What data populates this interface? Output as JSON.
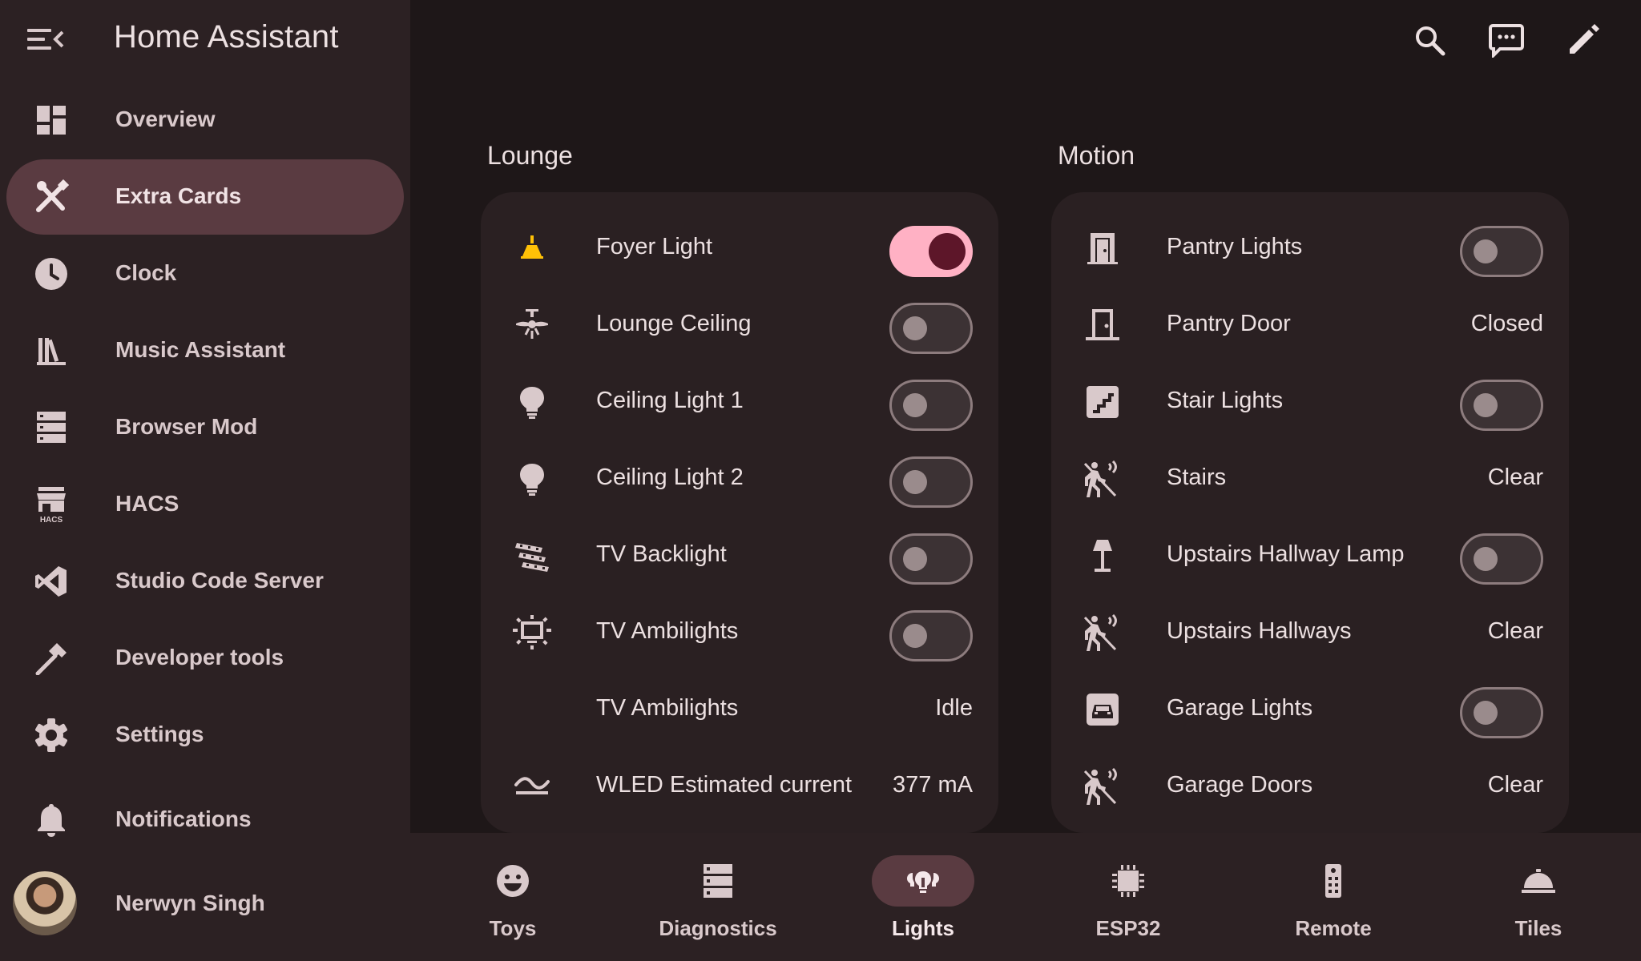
{
  "app": {
    "title": "Home Assistant"
  },
  "sidebar": {
    "items": [
      {
        "label": "Overview",
        "icon": "dashboard-icon"
      },
      {
        "label": "Extra Cards",
        "icon": "tools-icon",
        "active": true
      },
      {
        "label": "Clock",
        "icon": "clock-icon"
      },
      {
        "label": "Music Assistant",
        "icon": "music-library-icon"
      },
      {
        "label": "Browser Mod",
        "icon": "server-icon"
      },
      {
        "label": "HACS",
        "icon": "hacs-icon"
      },
      {
        "label": "Studio Code Server",
        "icon": "vscode-icon"
      },
      {
        "label": "Developer tools",
        "icon": "hammer-icon"
      },
      {
        "label": "Settings",
        "icon": "gear-icon"
      },
      {
        "label": "Notifications",
        "icon": "bell-icon"
      }
    ],
    "user": {
      "name": "Nerwyn Singh"
    }
  },
  "topbar": {
    "icons": [
      "search-icon",
      "assist-chat-icon",
      "edit-pencil-icon"
    ]
  },
  "sections": {
    "lounge": {
      "title": "Lounge",
      "rows": [
        {
          "name": "Foyer Light",
          "icon": "ceiling-light-icon",
          "type": "toggle",
          "on": true
        },
        {
          "name": "Lounge Ceiling",
          "icon": "ceiling-fan-light-icon",
          "type": "toggle",
          "on": false
        },
        {
          "name": "Ceiling Light 1",
          "icon": "lightbulb-icon",
          "type": "toggle",
          "on": false
        },
        {
          "name": "Ceiling Light 2",
          "icon": "lightbulb-icon",
          "type": "toggle",
          "on": false
        },
        {
          "name": "TV Backlight",
          "icon": "led-strip-icon",
          "type": "toggle",
          "on": false
        },
        {
          "name": "TV Ambilights",
          "icon": "television-ambient-light-icon",
          "type": "toggle",
          "on": false
        },
        {
          "name": "TV Ambilights",
          "icon": "",
          "type": "state",
          "state": "Idle"
        },
        {
          "name": "WLED Estimated current",
          "icon": "current-ac-icon",
          "type": "state",
          "state": "377 mA"
        }
      ]
    },
    "motion": {
      "title": "Motion",
      "rows": [
        {
          "name": "Pantry Lights",
          "icon": "door-light-icon",
          "type": "toggle",
          "on": false
        },
        {
          "name": "Pantry Door",
          "icon": "door-closed-icon",
          "type": "state",
          "state": "Closed"
        },
        {
          "name": "Stair Lights",
          "icon": "stairs-icon",
          "type": "toggle",
          "on": false
        },
        {
          "name": "Stairs",
          "icon": "motion-sensor-icon",
          "type": "state",
          "state": "Clear"
        },
        {
          "name": "Upstairs Hallway Lamp",
          "icon": "floor-lamp-icon",
          "type": "toggle",
          "on": false
        },
        {
          "name": "Upstairs Hallways",
          "icon": "motion-sensor-icon",
          "type": "state",
          "state": "Clear"
        },
        {
          "name": "Garage Lights",
          "icon": "garage-car-icon",
          "type": "toggle",
          "on": false
        },
        {
          "name": "Garage Doors",
          "icon": "motion-sensor-icon",
          "type": "state",
          "state": "Clear"
        }
      ]
    }
  },
  "bottom_nav": [
    {
      "label": "Toys",
      "icon": "emoticon-icon"
    },
    {
      "label": "Diagnostics",
      "icon": "server-icon"
    },
    {
      "label": "Lights",
      "icon": "lightbulb-group-icon",
      "active": true
    },
    {
      "label": "ESP32",
      "icon": "chip-icon"
    },
    {
      "label": "Remote",
      "icon": "remote-icon"
    },
    {
      "label": "Tiles",
      "icon": "room-service-icon"
    }
  ],
  "colors": {
    "accent": "#ffb1c4",
    "active_pill": "#5a3b41",
    "foyer_icon": "#ffc107",
    "background": "#1e1718",
    "sidebar": "#2c2123",
    "card": "#2a2022"
  }
}
